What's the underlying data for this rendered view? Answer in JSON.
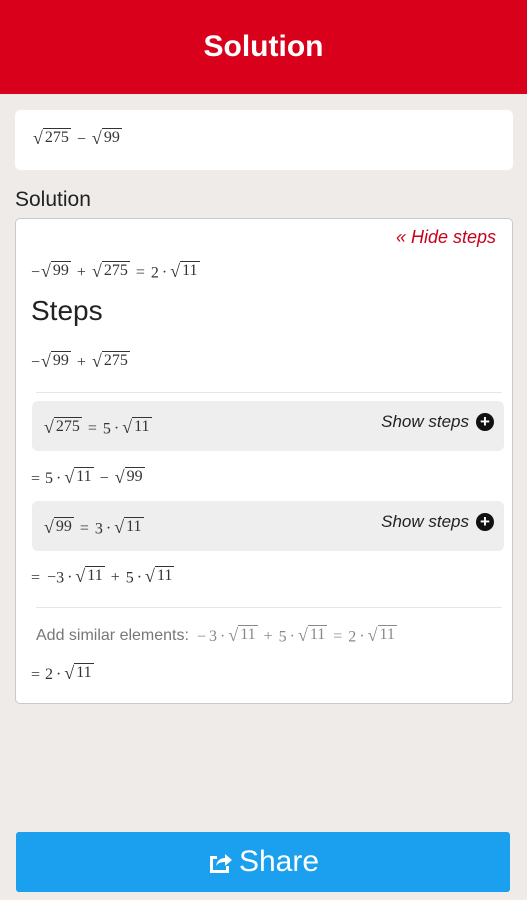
{
  "header": {
    "title": "Solution"
  },
  "input_expression": {
    "a": "275",
    "op": "−",
    "b": "99"
  },
  "section_label": "Solution",
  "hide_steps_label": "« Hide steps",
  "result": {
    "neg": "−",
    "a": "99",
    "op": "+",
    "b": "275",
    "eq": "=",
    "coef": "2",
    "dot": "·",
    "root": "11"
  },
  "steps_title": "Steps",
  "step1": {
    "neg": "−",
    "a": "99",
    "op": "+",
    "b": "275"
  },
  "substep1": {
    "radicand": "275",
    "eq": "=",
    "coef": "5",
    "dot": "·",
    "root": "11",
    "show_label": "Show steps"
  },
  "step2": {
    "eq": "=",
    "coef": "5",
    "dot": "·",
    "root": "11",
    "op": "−",
    "b": "99"
  },
  "substep2": {
    "radicand": "99",
    "eq": "=",
    "coef": "3",
    "dot": "·",
    "root": "11",
    "show_label": "Show steps"
  },
  "step3": {
    "eq": "=",
    "neg": "−",
    "c1": "3",
    "dot": "·",
    "r1": "11",
    "op": "+",
    "c2": "5",
    "r2": "11"
  },
  "similar": {
    "label": "Add similar elements:",
    "neg": "−",
    "c1": "3",
    "dot": "·",
    "r1": "11",
    "op": "+",
    "c2": "5",
    "r2": "11",
    "eq": "=",
    "c3": "2",
    "r3": "11"
  },
  "final": {
    "eq": "=",
    "coef": "2",
    "dot": "·",
    "root": "11"
  },
  "share": {
    "label": "Share"
  },
  "colors": {
    "header": "#d9001b",
    "accent_link": "#c8001a",
    "share_button": "#1aa0ee",
    "background": "#eeebe9"
  },
  "icons": {
    "share": "share-icon",
    "plus": "plus-circle-icon"
  }
}
